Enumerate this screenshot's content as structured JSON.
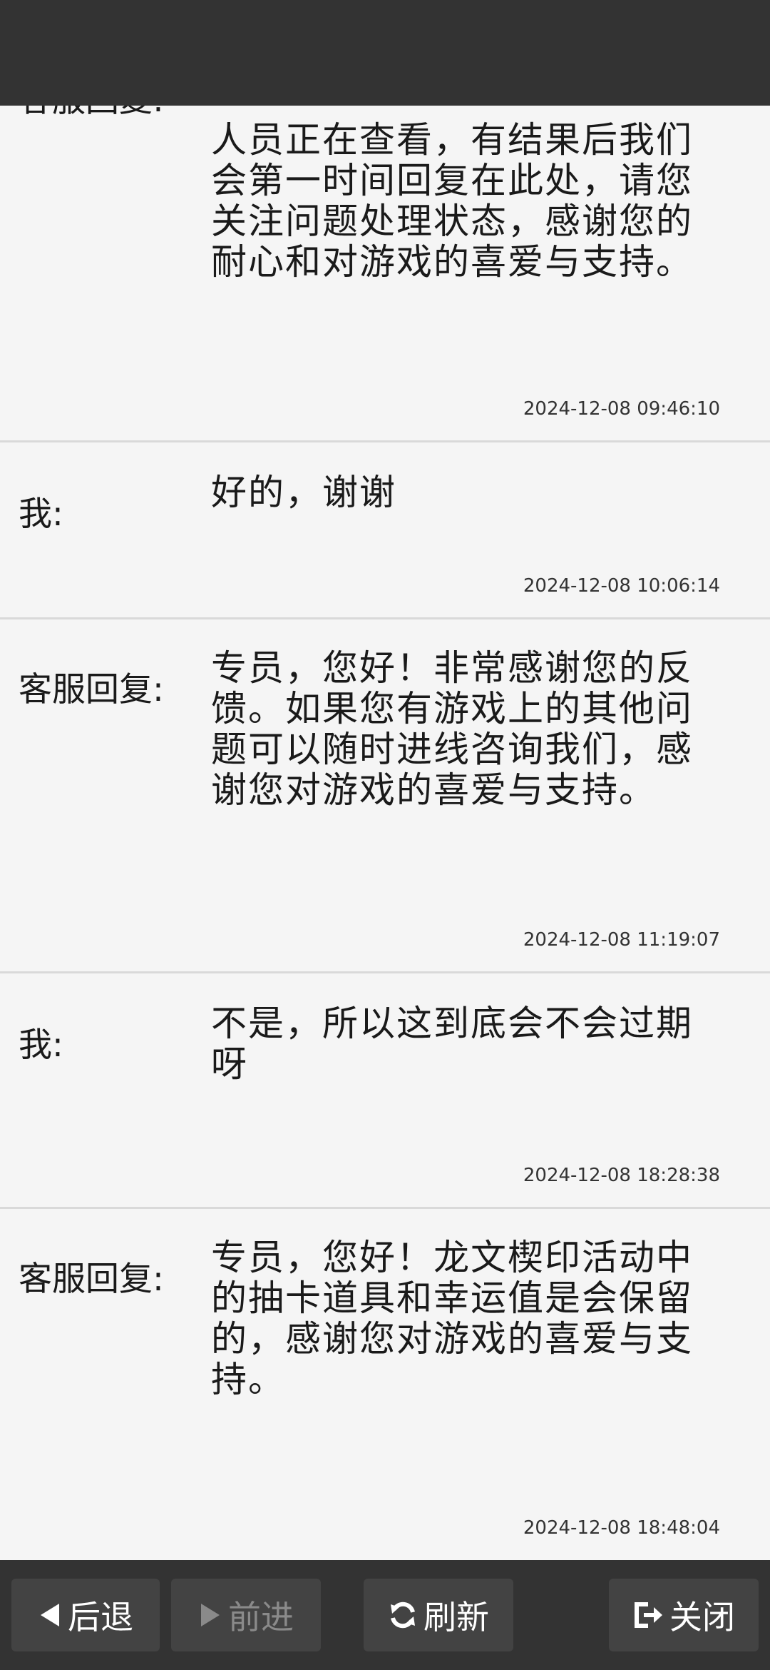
{
  "messages": [
    {
      "speaker": "客服回复:",
      "lines": [
        "人员正在查看，有结果后我们",
        "会第一时间回复在此处，请您",
        "关注问题处理状态，感谢您的",
        "耐心和对游戏的喜爱与支持。"
      ],
      "time": "2024-12-08 09:46:10"
    },
    {
      "speaker": "我:",
      "lines": [
        "好的，谢谢"
      ],
      "time": "2024-12-08 10:06:14"
    },
    {
      "speaker": "客服回复:",
      "lines": [
        "专员，您好！非常感谢您的反",
        "馈。如果您有游戏上的其他问",
        "题可以随时进线咨询我们，感",
        "谢您对游戏的喜爱与支持。"
      ],
      "time": "2024-12-08 11:19:07"
    },
    {
      "speaker": "我:",
      "lines": [
        "不是，所以这到底会不会过期",
        "呀"
      ],
      "time": "2024-12-08 18:28:38"
    },
    {
      "speaker": "客服回复:",
      "lines": [
        "专员，您好！龙文楔印活动中",
        "的抽卡道具和幸运值是会保留",
        "的，感谢您对游戏的喜爱与支",
        "持。"
      ],
      "time": "2024-12-08 18:48:04"
    }
  ],
  "toolbar": {
    "back_label": "后退",
    "forward_label": "前进",
    "refresh_label": "刷新",
    "close_label": "关闭"
  }
}
